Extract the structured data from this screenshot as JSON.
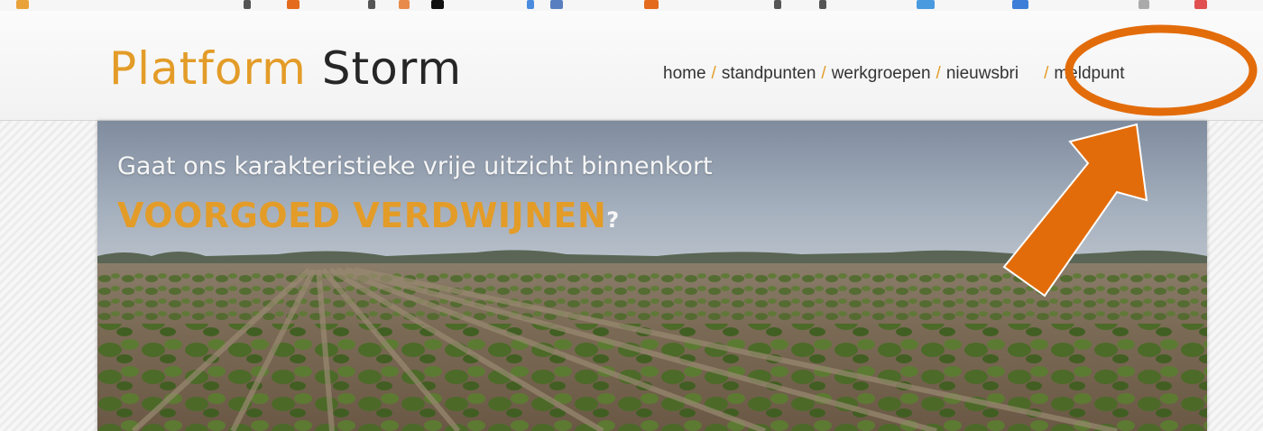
{
  "site": {
    "logo": {
      "word1": "Platform",
      "word2": "Storm"
    },
    "nav": {
      "items": [
        "home",
        "standpunten",
        "werkgroepen",
        "nieuwsbri",
        "meldpunt"
      ],
      "separator": "/"
    }
  },
  "hero": {
    "line1": "Gaat ons karakteristieke vrije uitzicht binnenkort",
    "line2": "VOORGOED VERDWIJNEN",
    "line2_suffix": "?"
  },
  "annotation": {
    "color": "#e36c0a",
    "target": "meldpunt"
  },
  "colors": {
    "accent": "#e39c28",
    "text_dark": "#262626"
  }
}
